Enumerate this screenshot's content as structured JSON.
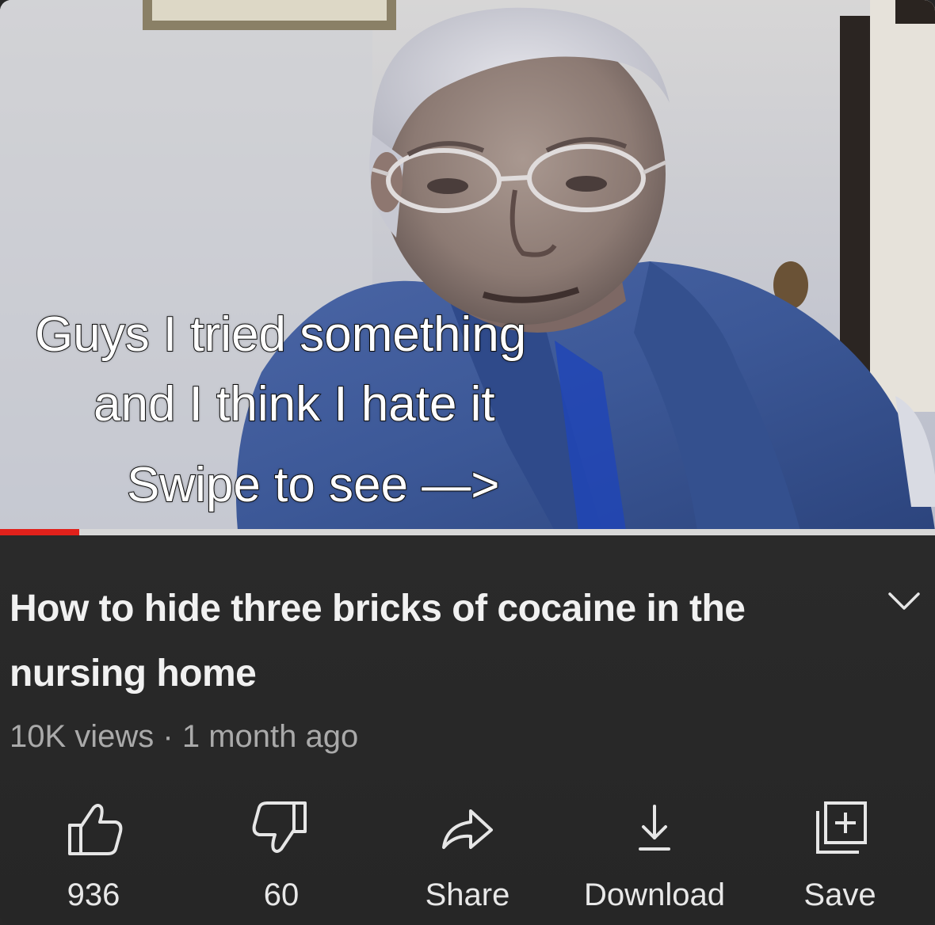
{
  "video": {
    "overlay_lines": [
      "Guys I tried something",
      "and I think I hate it",
      "Swipe to see —>"
    ],
    "progress_played_fraction": 0.085
  },
  "info": {
    "title": "How to hide three bricks of cocaine in the nursing home",
    "meta": "10K views · 1 month ago",
    "expand_icon": "chevron-down-icon"
  },
  "actions": [
    {
      "label": "936",
      "icon": "thumbs-up-icon"
    },
    {
      "label": "60",
      "icon": "thumbs-down-icon"
    },
    {
      "label": "Share",
      "icon": "share-arrow-icon"
    },
    {
      "label": "Download",
      "icon": "download-icon"
    },
    {
      "label": "Save",
      "icon": "save-playlist-icon"
    }
  ],
  "colors": {
    "panel_bg": "#272727",
    "title_text": "#f1f1f1",
    "meta_text": "#aaaaaa",
    "progress_played": "#e1211b",
    "progress_track": "#d8d8d8"
  }
}
